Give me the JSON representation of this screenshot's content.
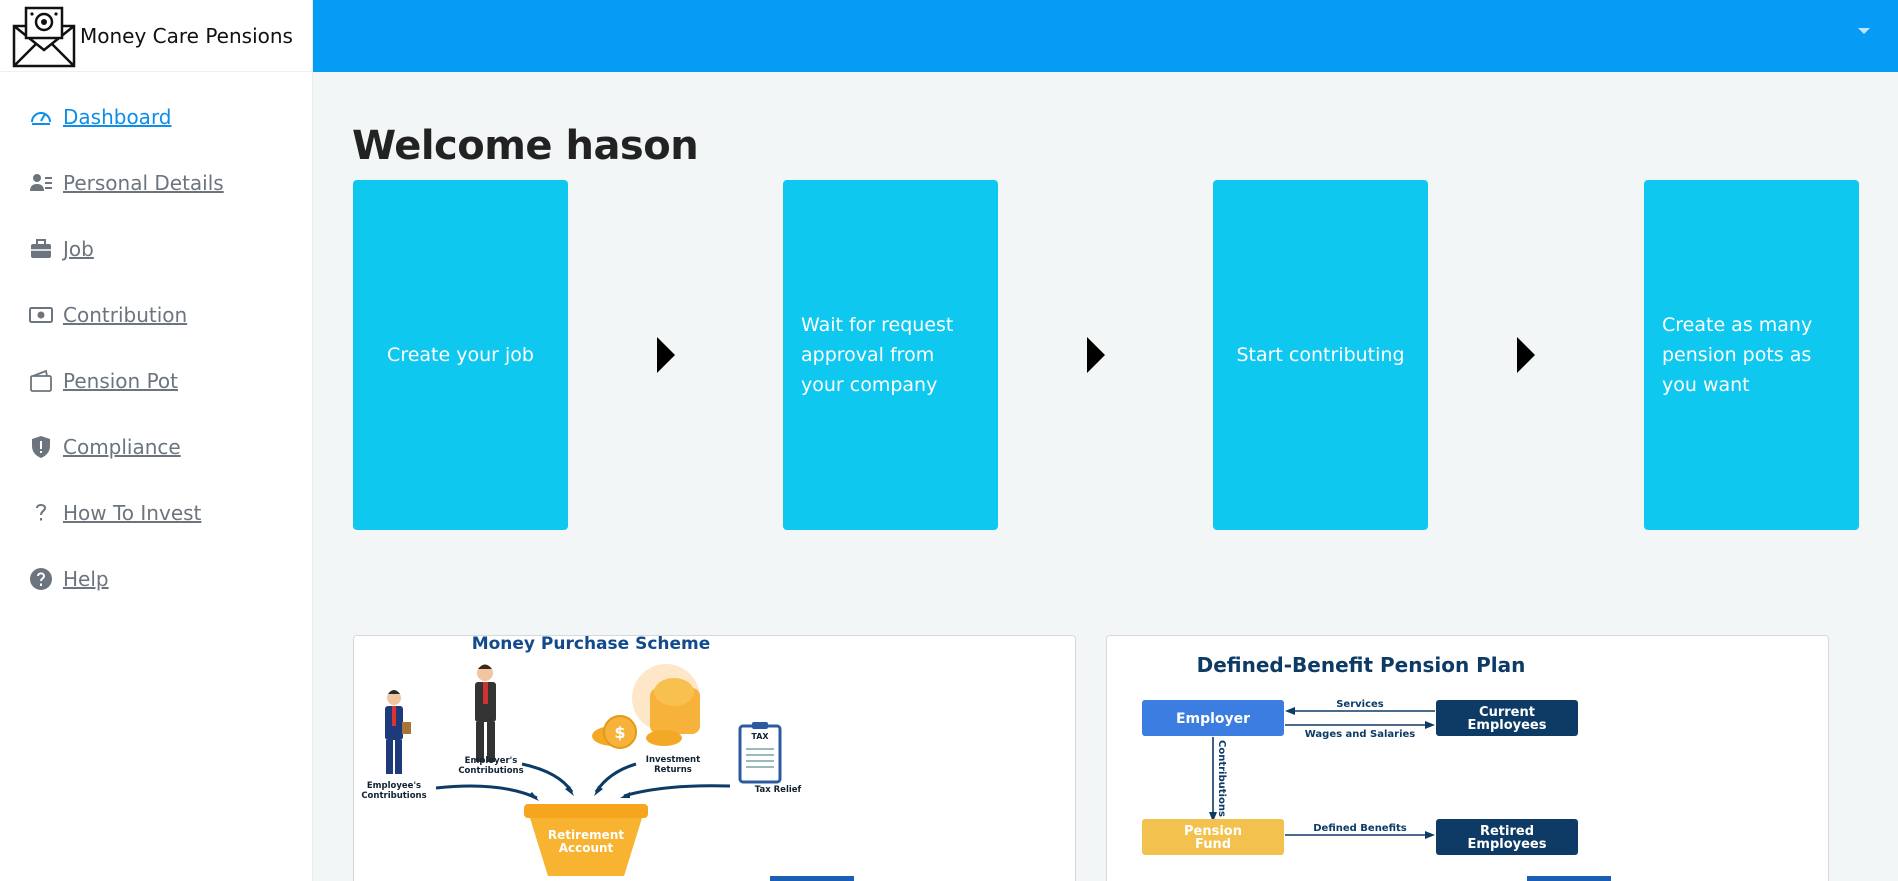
{
  "brand": {
    "name": "Money Care Pensions"
  },
  "nav": [
    {
      "label": "Dashboard",
      "icon": "dashboard-icon",
      "active": true
    },
    {
      "label": "Personal Details",
      "icon": "user-details-icon"
    },
    {
      "label": "Job",
      "icon": "briefcase-icon"
    },
    {
      "label": "Contribution",
      "icon": "cash-icon"
    },
    {
      "label": "Pension Pot",
      "icon": "wallet-icon"
    },
    {
      "label": "Compliance",
      "icon": "shield-icon"
    },
    {
      "label": "How To Invest",
      "icon": "question-icon"
    },
    {
      "label": "Help",
      "icon": "help-circle-icon"
    }
  ],
  "main": {
    "welcome": "Welcome hason",
    "steps": [
      {
        "text": "Create your job"
      },
      {
        "text": "Wait for request approval from your company"
      },
      {
        "text": "Start contributing"
      },
      {
        "text": "Create as many pension pots as you want"
      }
    ]
  },
  "cards": {
    "money_purchase": {
      "title": "Money Purchase Scheme",
      "employee_contrib": [
        "Employee's",
        "Contributions"
      ],
      "employer_contrib": [
        "Employer's",
        "Contributions"
      ],
      "investment": [
        "Investment",
        "Returns"
      ],
      "tax_label": "TAX",
      "tax_relief": "Tax Relief",
      "retirement": [
        "Retirement",
        "Account"
      ]
    },
    "defined_benefit": {
      "title": "Defined-Benefit Pension Plan",
      "employer": "Employer",
      "current_employees": [
        "Current",
        "Employees"
      ],
      "services": "Services",
      "wages": "Wages and Salaries",
      "contributions": "Contributions",
      "pension_fund": [
        "Pension",
        "Fund"
      ],
      "defined_benefits": "Defined Benefits",
      "retired_employees": [
        "Retired",
        "Employees"
      ]
    }
  },
  "colors": {
    "topbar": "#069cf6",
    "step": "#0fc8ef",
    "active_nav": "#0d8ee8",
    "diagram_blue": "#3b7de0",
    "diagram_navy": "#0d3b66",
    "diagram_gold": "#f2c14e"
  }
}
